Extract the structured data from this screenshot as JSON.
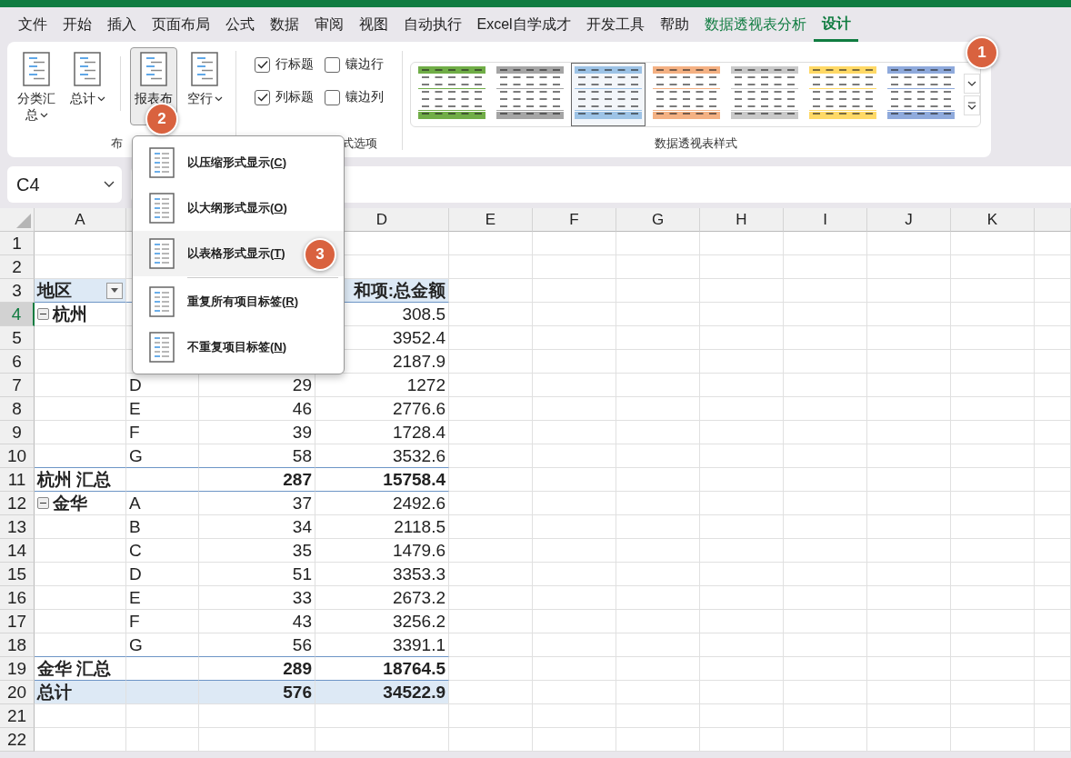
{
  "tabs": [
    {
      "label": "文件",
      "selected": false,
      "contextual": false
    },
    {
      "label": "开始",
      "selected": false,
      "contextual": false
    },
    {
      "label": "插入",
      "selected": false,
      "contextual": false
    },
    {
      "label": "页面布局",
      "selected": false,
      "contextual": false
    },
    {
      "label": "公式",
      "selected": false,
      "contextual": false
    },
    {
      "label": "数据",
      "selected": false,
      "contextual": false
    },
    {
      "label": "审阅",
      "selected": false,
      "contextual": false
    },
    {
      "label": "视图",
      "selected": false,
      "contextual": false
    },
    {
      "label": "自动执行",
      "selected": false,
      "contextual": false
    },
    {
      "label": "Excel自学成才",
      "selected": false,
      "contextual": false
    },
    {
      "label": "开发工具",
      "selected": false,
      "contextual": false
    },
    {
      "label": "帮助",
      "selected": false,
      "contextual": false
    },
    {
      "label": "数据透视表分析",
      "selected": false,
      "contextual": true
    },
    {
      "label": "设计",
      "selected": true,
      "contextual": true
    }
  ],
  "ribbon": {
    "layout_group": {
      "label": "布",
      "buttons": [
        {
          "kind": "button",
          "label": "分类汇总",
          "pressed": false
        },
        {
          "kind": "button",
          "label": "总计",
          "pressed": false
        },
        {
          "kind": "divider"
        },
        {
          "kind": "button",
          "label": "报表布",
          "pressed": true
        },
        {
          "kind": "button",
          "label": "空行",
          "pressed": false
        }
      ]
    },
    "options_group": {
      "label": "式选项",
      "checkboxes": [
        {
          "label": "行标题",
          "checked": true
        },
        {
          "label": "镶边行",
          "checked": false
        },
        {
          "label": "列标题",
          "checked": true
        },
        {
          "label": "镶边列",
          "checked": false
        }
      ]
    },
    "styles_group": {
      "label": "数据透视表样式",
      "styles": [
        {
          "color": "#70ad47",
          "selected": false
        },
        {
          "color": "#a5a5a5",
          "selected": false
        },
        {
          "color": "#9dc3e6",
          "selected": true
        },
        {
          "color": "#f4b183",
          "selected": false
        },
        {
          "color": "#c9c9c9",
          "selected": false
        },
        {
          "color": "#ffd966",
          "selected": false
        },
        {
          "color": "#8faadc",
          "selected": false
        }
      ]
    }
  },
  "name_box": {
    "value": "C4"
  },
  "layout_menu": {
    "items": [
      {
        "kind": "item",
        "before": "以压缩形式显示(",
        "key": "C",
        "after": ")",
        "selected": false
      },
      {
        "kind": "item",
        "before": "以大纲形式显示(",
        "key": "O",
        "after": ")",
        "selected": false
      },
      {
        "kind": "item",
        "before": "以表格形式显示(",
        "key": "T",
        "after": ")",
        "selected": true
      },
      {
        "kind": "separator"
      },
      {
        "kind": "item",
        "before": "重复所有项目标签(",
        "key": "R",
        "after": ")",
        "selected": false
      },
      {
        "kind": "item",
        "before": "不重复项目标签(",
        "key": "N",
        "after": ")",
        "selected": false
      }
    ]
  },
  "step_badges": [
    {
      "label": "1"
    },
    {
      "label": "2"
    },
    {
      "label": "3"
    }
  ],
  "sheet": {
    "columns": [
      {
        "label": "A",
        "selected": false
      },
      {
        "label": "D",
        "selected": false
      },
      {
        "label": "E",
        "selected": false
      },
      {
        "label": "F",
        "selected": false
      },
      {
        "label": "G",
        "selected": false
      },
      {
        "label": "H",
        "selected": false
      },
      {
        "label": "I",
        "selected": false
      },
      {
        "label": "J",
        "selected": false
      },
      {
        "label": "K",
        "selected": false
      }
    ],
    "rows": [
      {
        "number": "1",
        "kind": "empty",
        "selected": false
      },
      {
        "number": "2",
        "kind": "empty",
        "selected": false
      },
      {
        "number": "3",
        "kind": "header",
        "selected": false,
        "a": "地区",
        "d": "和项:总金额"
      },
      {
        "number": "4",
        "kind": "group",
        "selected": true,
        "a": "杭州",
        "d": "308.5"
      },
      {
        "number": "5",
        "kind": "item",
        "selected": false,
        "d": "3952.4"
      },
      {
        "number": "6",
        "kind": "item",
        "selected": false,
        "d": "2187.9"
      },
      {
        "number": "7",
        "kind": "item",
        "selected": false,
        "b": "D",
        "c": "29",
        "d": "1272"
      },
      {
        "number": "8",
        "kind": "item",
        "selected": false,
        "b": "E",
        "c": "46",
        "d": "2776.6"
      },
      {
        "number": "9",
        "kind": "item",
        "selected": false,
        "b": "F",
        "c": "39",
        "d": "1728.4"
      },
      {
        "number": "10",
        "kind": "item",
        "selected": false,
        "b": "G",
        "c": "58",
        "d": "3532.6"
      },
      {
        "number": "11",
        "kind": "subtotal",
        "selected": false,
        "a": "杭州 汇总",
        "c": "287",
        "d": "15758.4"
      },
      {
        "number": "12",
        "kind": "group",
        "selected": false,
        "a": "金华",
        "b": "A",
        "c": "37",
        "d": "2492.6"
      },
      {
        "number": "13",
        "kind": "item",
        "selected": false,
        "b": "B",
        "c": "34",
        "d": "2118.5"
      },
      {
        "number": "14",
        "kind": "item",
        "selected": false,
        "b": "C",
        "c": "35",
        "d": "1479.6"
      },
      {
        "number": "15",
        "kind": "item",
        "selected": false,
        "b": "D",
        "c": "51",
        "d": "3353.3"
      },
      {
        "number": "16",
        "kind": "item",
        "selected": false,
        "b": "E",
        "c": "33",
        "d": "2673.2"
      },
      {
        "number": "17",
        "kind": "item",
        "selected": false,
        "b": "F",
        "c": "43",
        "d": "3256.2"
      },
      {
        "number": "18",
        "kind": "item",
        "selected": false,
        "b": "G",
        "c": "56",
        "d": "3391.1"
      },
      {
        "number": "19",
        "kind": "subtotal",
        "selected": false,
        "a": "金华 汇总",
        "c": "289",
        "d": "18764.5"
      },
      {
        "number": "20",
        "kind": "total",
        "selected": false,
        "a": "总计",
        "c": "576",
        "d": "34522.9"
      },
      {
        "number": "21",
        "kind": "empty",
        "selected": false
      },
      {
        "number": "22",
        "kind": "empty",
        "selected": false
      }
    ]
  }
}
